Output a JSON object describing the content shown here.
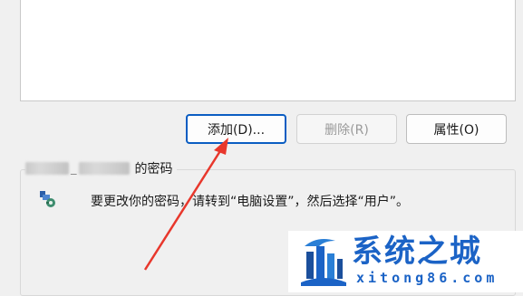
{
  "list": {
    "items": []
  },
  "buttons": {
    "add_label": "添加(D)...",
    "remove_label": "删除(R)",
    "properties_label": "属性(O)"
  },
  "password_section": {
    "user_name": "",
    "title_suffix": "的密码",
    "info_text": "要更改你的密码，请转到“电脑设置”，然后选择“用户”。",
    "icon": "user-key-icon"
  },
  "watermark": {
    "title": "系统之城",
    "url": "xitong86.com",
    "logo": "castle-logo"
  },
  "annotation": {
    "arrow_color": "#e8372c"
  },
  "colors": {
    "accent": "#0a5dc2",
    "watermark": "#1b63c6"
  }
}
